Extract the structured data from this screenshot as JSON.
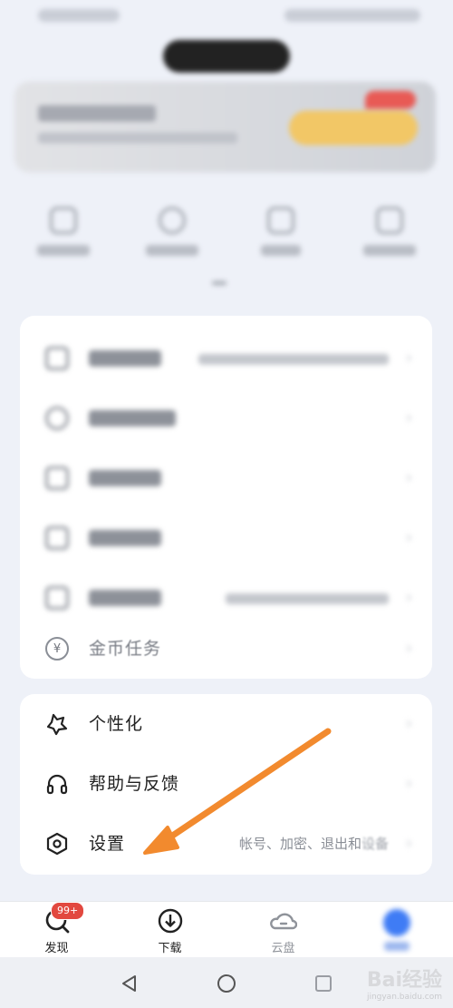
{
  "menu_secondary": {
    "coin_task": "金币任务"
  },
  "menu_main": [
    {
      "id": "personalize",
      "label": "个性化",
      "icon": "star-badge-icon"
    },
    {
      "id": "help",
      "label": "帮助与反馈",
      "icon": "headphones-icon"
    },
    {
      "id": "settings",
      "label": "设置",
      "icon": "hexagon-settings-icon",
      "sub": "帐号、加密、退出和"
    }
  ],
  "tabbar": [
    {
      "id": "discover",
      "label": "发现",
      "badge": "99+"
    },
    {
      "id": "download",
      "label": "下载"
    },
    {
      "id": "cloud",
      "label": "云盘"
    }
  ],
  "watermark": {
    "text": "Bai经验",
    "sub": "jingyan.baidu.com"
  },
  "colors": {
    "accent": "#3f7cf5",
    "badge": "#e2483f",
    "arrow": "#f28a2e"
  }
}
